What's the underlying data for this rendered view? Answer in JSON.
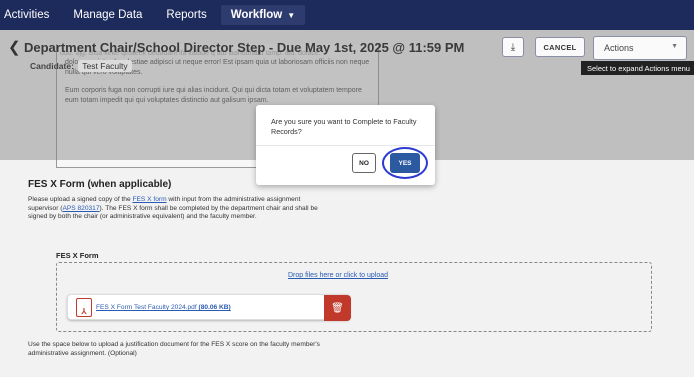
{
  "nav": {
    "items": [
      "Activities",
      "Manage Data",
      "Reports"
    ],
    "active": "Workflow"
  },
  "header": {
    "title": "Department Chair/School Director Step - Due May 1st, 2025 @ 11:59 PM",
    "cancel_label": "CANCEL",
    "actions_label": "Actions",
    "tooltip": "Select to expand Actions menu"
  },
  "candidate": {
    "label": "Candidate:",
    "name": "Test Faculty"
  },
  "textbox": {
    "ghost": "ddd. ajg. Bisa keke qmaeek dedadahf ifa kalaue q atb laanuurabd tamp. aid. dolace.",
    "para1": "dolor eveniet vel molestiae adipisci ut neque error! Est ipsam quia ut laboriosam officiis non neque nulla qui vero voluptates.",
    "para2": "Eum corporis fuga non corrupti iure qui alias incidunt. Qui qui dicta totam et voluptatem tempore eum totam impedit qui qui voluptates distinctio aut galisum ipsam."
  },
  "section": {
    "title": "FES X  Form (when applicable)",
    "desc_a": "Please upload a signed copy of the ",
    "link1": "FES X form",
    "desc_b": " with input from the administrative assignment supervisor (",
    "link2": "APS 820317",
    "desc_c": "). The FES X form shall be completed by the department chair and shall be signed by both the chair (or administrative equivalent) and the faculty member."
  },
  "upload": {
    "label": "FES X Form",
    "drop_text": "Drop files here or click to upload",
    "file_name": "FES X Form Test Faculty 2024.pdf ",
    "file_size": "(80.06 KB)"
  },
  "bottom_desc": "Use the space below to upload a justification document for the FES X score on the faculty member's administrative assignment. (Optional)",
  "modal": {
    "message": "Are you sure you want to Complete to Faculty Records?",
    "no_label": "NO",
    "yes_label": "YES"
  }
}
